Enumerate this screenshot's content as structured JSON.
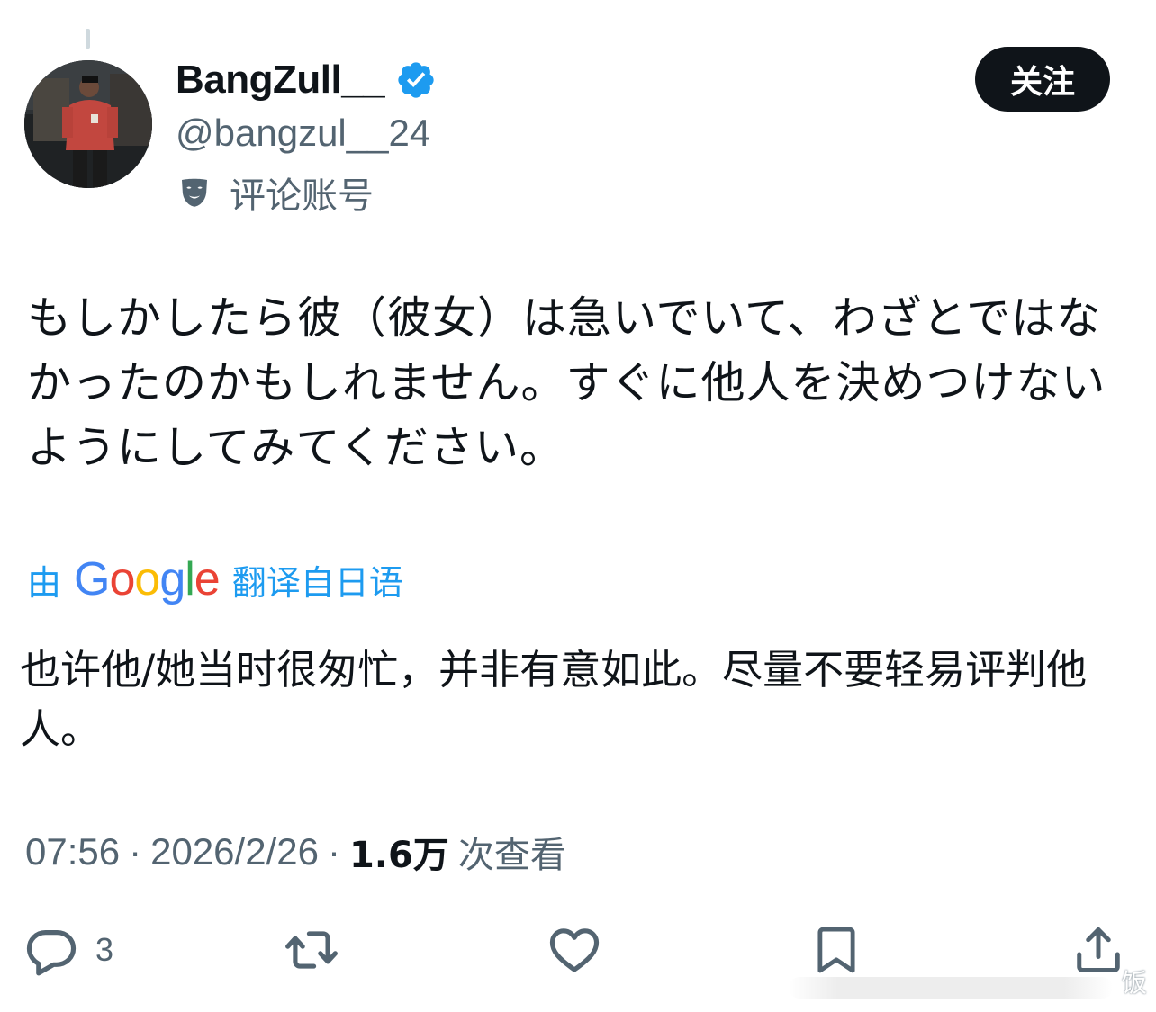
{
  "author": {
    "display_name": "BangZull__",
    "handle": "@bangzul__24",
    "account_label": "评论账号",
    "verified": true
  },
  "follow_button": {
    "label": "关注"
  },
  "tweet": {
    "text": "もしかしたら彼（彼女）は急いでいて、わざとではなかったのかもしれません。すぐに他人を決めつけないようにしてみてください。"
  },
  "translation": {
    "prefix": "由",
    "provider": "Google",
    "suffix": "翻译自日语",
    "text": "也许他/她当时很匆忙，并非有意如此。尽量不要轻易评判他人。"
  },
  "meta": {
    "time": "07:56",
    "separator": "·",
    "date": "2026/2/26",
    "views_count": "1.6万",
    "views_label": "次查看"
  },
  "actions": {
    "reply_count": "3"
  },
  "colors": {
    "accent": "#1d9bf0",
    "text_primary": "#0f1419",
    "text_secondary": "#536471",
    "follow_bg": "#0f1419"
  },
  "icons": {
    "verified": "verified-badge-icon",
    "account_label": "mask-icon",
    "reply": "reply-icon",
    "retweet": "retweet-icon",
    "like": "heart-icon",
    "bookmark": "bookmark-icon",
    "share": "share-icon"
  },
  "watermark": "饭"
}
